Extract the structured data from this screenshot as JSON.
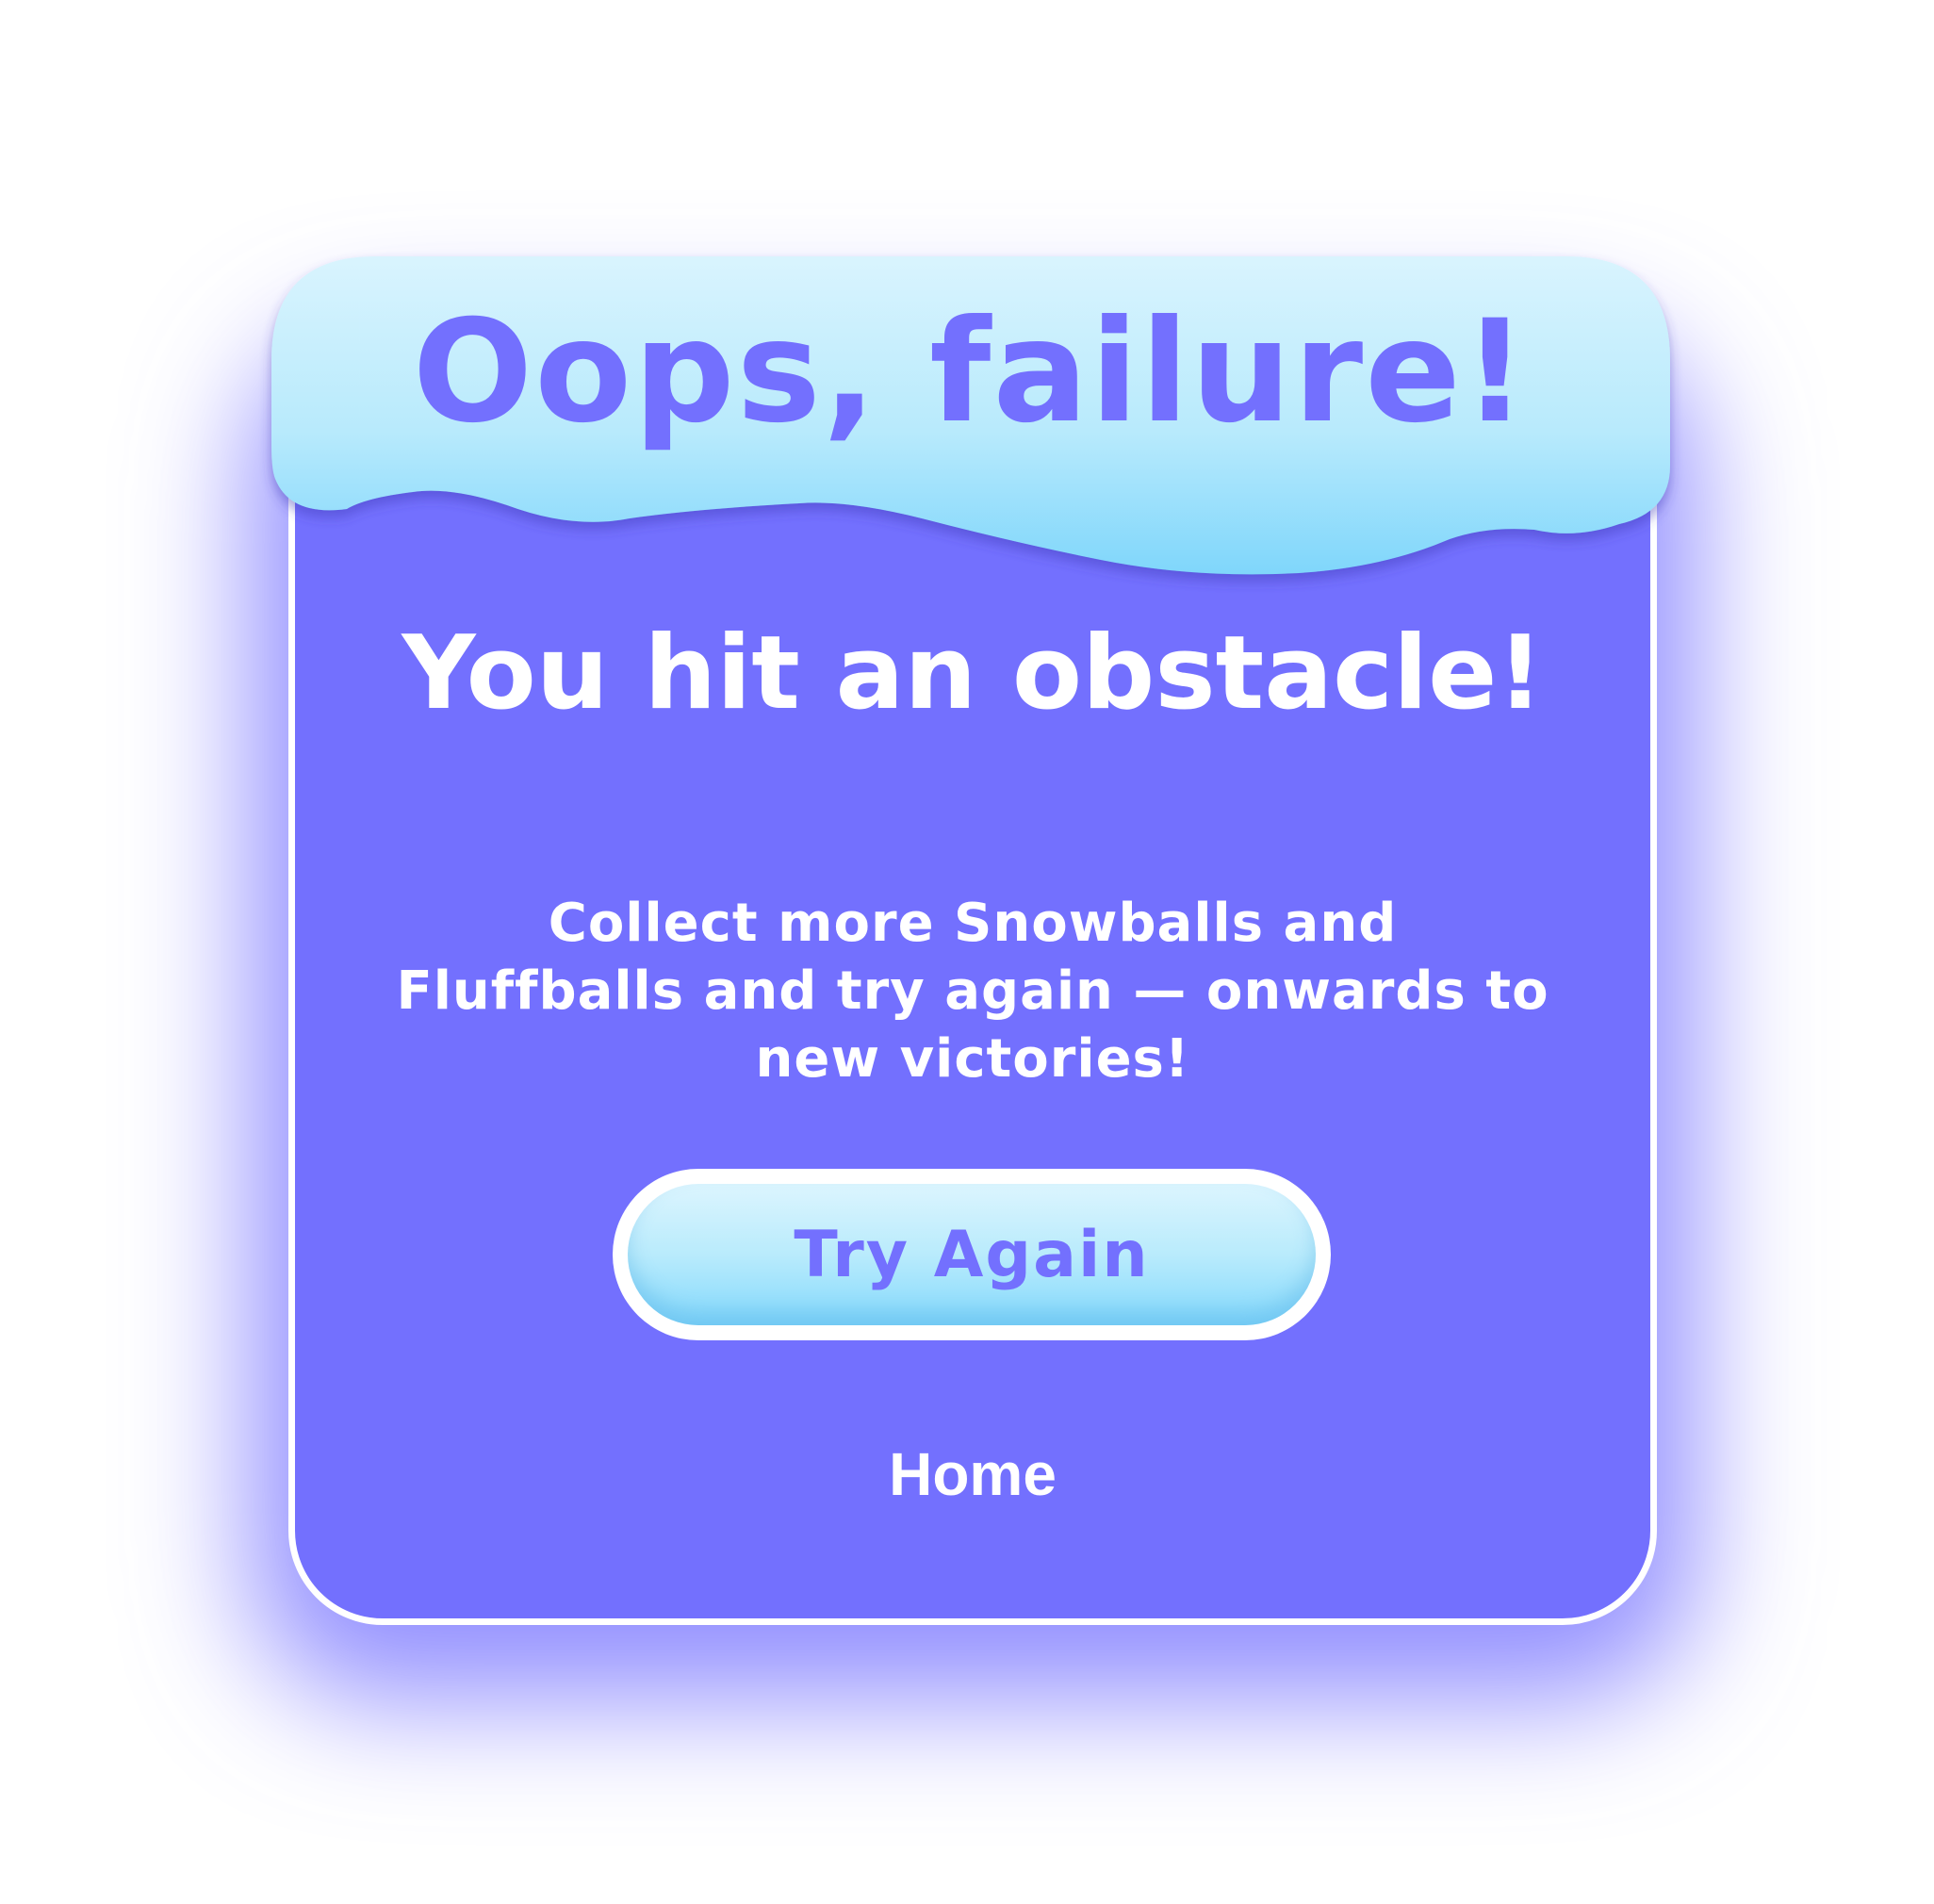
{
  "dialog": {
    "banner_title": "Oops, failure!",
    "headline": "You hit an obstacle!",
    "description": "Collect more Snowballs and Fluffballs and try again — onwards to new victories!",
    "primary_button_label": "Try Again",
    "secondary_link_label": "Home"
  },
  "colors": {
    "panel_background": "#7370fe",
    "accent_text": "#7370fe",
    "banner_top": "#d8f4fe",
    "banner_bottom": "#80d8fc",
    "panel_border": "#ffffff",
    "text_light": "#ffffff"
  }
}
